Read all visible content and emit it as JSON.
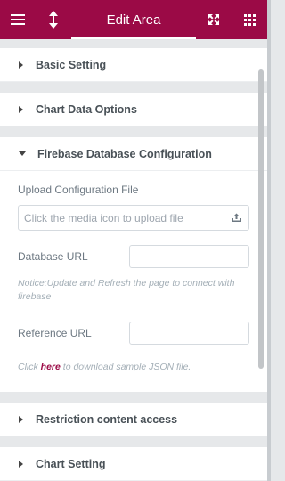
{
  "header": {
    "title": "Edit Area",
    "menu_icon": "hamburger-icon",
    "resize_icon": "vertical-resize-icon",
    "fullscreen_icon": "expand-icon",
    "apps_icon": "grid-icon"
  },
  "colors": {
    "accent": "#9b0a46",
    "panel_bg": "#ffffff",
    "page_bg": "#e6e8ea",
    "label_text": "#6d7882"
  },
  "sections": {
    "basic_setting": "Basic Setting",
    "chart_data_options": "Chart Data Options",
    "firebase_config": "Firebase Database Configuration",
    "restriction": "Restriction content access",
    "chart_setting": "Chart Setting"
  },
  "firebase": {
    "upload_label": "Upload Configuration File",
    "upload_placeholder": "Click the media icon to upload file",
    "upload_icon": "media-upload-icon",
    "database_url_label": "Database URL",
    "database_url_value": "",
    "notice": "Notice:Update and Refresh the page to connect with firebase",
    "reference_url_label": "Reference URL",
    "reference_url_value": "",
    "sample_prefix": "Click ",
    "sample_link": "here",
    "sample_suffix": " to download sample JSON file."
  }
}
